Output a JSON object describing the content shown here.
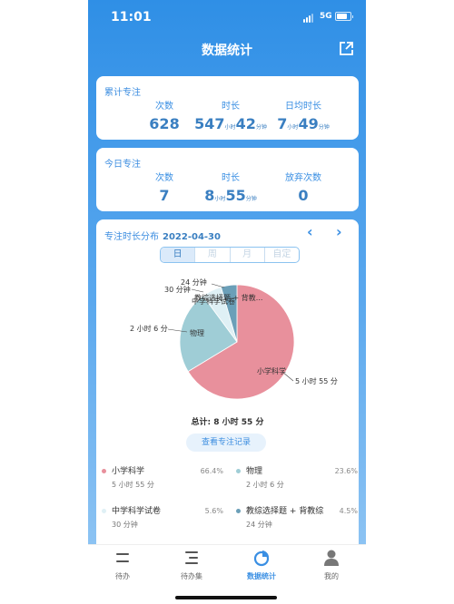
{
  "status": {
    "time": "11:01",
    "network": "5G"
  },
  "header": {
    "title": "数据统计",
    "share_icon": "share-icon"
  },
  "cumulative": {
    "title": "累计专注",
    "count_label": "次数",
    "count": "628",
    "duration_label": "时长",
    "duration_h": "547",
    "duration_h_unit": "小时",
    "duration_m": "42",
    "duration_m_unit": "分钟",
    "daily_label": "日均时长",
    "daily_h": "7",
    "daily_h_unit": "小时",
    "daily_m": "49",
    "daily_m_unit": "分钟"
  },
  "today": {
    "title": "今日专注",
    "count_label": "次数",
    "count": "7",
    "duration_label": "时长",
    "duration_h": "8",
    "duration_h_unit": "小时",
    "duration_m": "55",
    "duration_m_unit": "分钟",
    "abandon_label": "放弃次数",
    "abandon": "0"
  },
  "distribution": {
    "title": "专注时长分布",
    "date": "2022-04-30",
    "prev": "‹",
    "next": "›",
    "segments": [
      "日",
      "周",
      "月",
      "自定"
    ],
    "total": "总计: 8 小时 55 分",
    "record_button": "查看专注记录"
  },
  "chart_data": {
    "type": "pie",
    "slices": [
      {
        "name": "小学科学",
        "duration": "5 小时 55 分",
        "percent": 66.4,
        "percent_text": "66.4%",
        "color": "#e8909c",
        "short_label": "小学科学",
        "time_label": "5 小时 55 分"
      },
      {
        "name": "物理",
        "duration": "2 小时 6 分",
        "percent": 23.6,
        "percent_text": "23.6%",
        "color": "#9fcdd6",
        "short_label": "物理",
        "time_label": "2 小时 6 分"
      },
      {
        "name": "中学科学试卷",
        "duration": "30 分钟",
        "percent": 5.6,
        "percent_text": "5.6%",
        "color": "#dff0f5",
        "short_label": "中学科学试卷",
        "time_label": "30 分钟"
      },
      {
        "name": "教综选择题 + 背教综",
        "duration": "24 分钟",
        "percent": 4.5,
        "percent_text": "4.5%",
        "color": "#6b9fb8",
        "short_label": "教综选择题 + 背教...",
        "time_label": "24 分钟"
      }
    ]
  },
  "tabs": [
    {
      "label": "待办",
      "icon": "todo-icon"
    },
    {
      "label": "待办集",
      "icon": "todo-set-icon"
    },
    {
      "label": "数据统计",
      "icon": "pie-chart-icon",
      "active": true
    },
    {
      "label": "我的",
      "icon": "person-icon"
    }
  ]
}
